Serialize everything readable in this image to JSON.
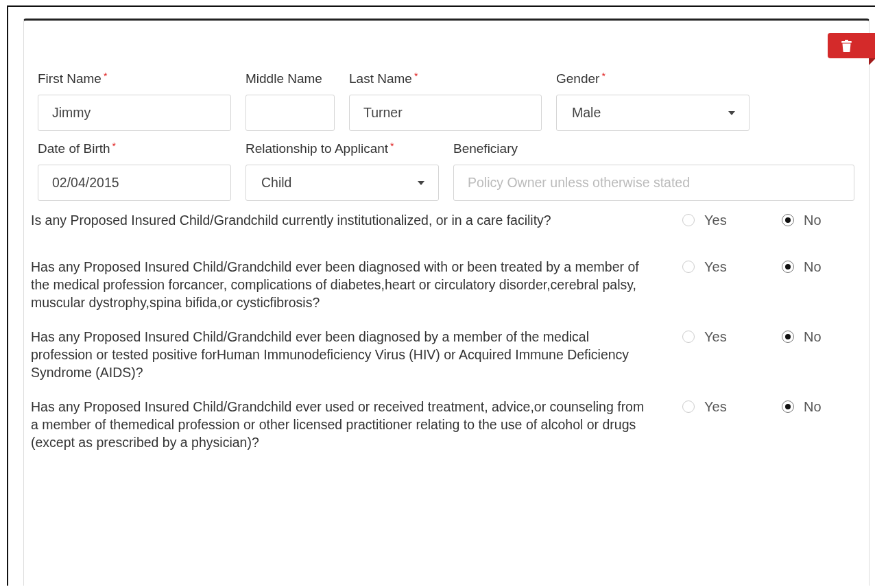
{
  "field_rows": [
    {
      "fields": [
        {
          "kind": "input",
          "label": "First Name",
          "required_mark": "*",
          "value": "Jimmy"
        },
        {
          "kind": "input",
          "label": "Middle Name"
        },
        {
          "kind": "input",
          "label": "Last Name",
          "required_mark": "*",
          "value": "Turner"
        },
        {
          "kind": "select",
          "label": "Gender",
          "required_mark": "*",
          "value": "Male"
        }
      ]
    },
    {
      "fields": [
        {
          "kind": "input",
          "label": "Date of Birth",
          "required_mark": "*",
          "value": "02/04/2015"
        },
        {
          "kind": "select",
          "label": "Relationship to Applicant",
          "required_mark": "*",
          "value": "Child"
        },
        {
          "kind": "input",
          "label": "Beneficiary",
          "placeholder": "Policy Owner unless otherwise stated"
        }
      ]
    }
  ],
  "questions": [
    {
      "text": "Is any Proposed Insured Child/Grandchild currently institutionalized, or in a care facility?",
      "options": [
        {
          "label": "Yes",
          "selected": false
        },
        {
          "label": "No",
          "selected": true
        }
      ]
    },
    {
      "text": "Has any Proposed Insured Child/Grandchild ever been diagnosed with or been treated by a member of the medical profession forcancer, complications of diabetes,heart or circulatory disorder,cerebral palsy, muscular dystrophy,spina bifida,or cysticfibrosis?",
      "options": [
        {
          "label": "Yes",
          "selected": false
        },
        {
          "label": "No",
          "selected": true
        }
      ]
    },
    {
      "text": "Has any Proposed Insured Child/Grandchild ever been diagnosed by a member of the medical profession or tested positive forHuman Immunodeficiency Virus (HIV) or Acquired Immune Deficiency Syndrome (AIDS)?",
      "options": [
        {
          "label": "Yes",
          "selected": false
        },
        {
          "label": "No",
          "selected": true
        }
      ]
    },
    {
      "text": "Has any Proposed Insured Child/Grandchild ever used or received treatment, advice,or counseling from a member of themedical profession or other licensed practitioner relating to the use of alcohol or drugs (except as prescribed by a physician)?",
      "options": [
        {
          "label": "Yes",
          "selected": false
        },
        {
          "label": "No",
          "selected": true
        }
      ]
    }
  ]
}
